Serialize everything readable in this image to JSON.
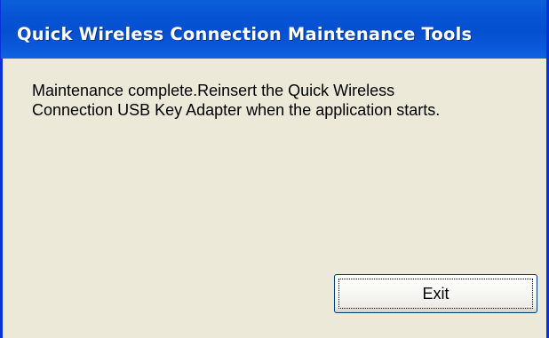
{
  "window": {
    "title": "Quick Wireless Connection Maintenance Tools"
  },
  "message": {
    "line1": "Maintenance complete.Reinsert the Quick Wireless",
    "line2": "Connection USB Key Adapter when the application starts."
  },
  "buttons": {
    "exit_label": "Exit"
  },
  "colors": {
    "title_bar": "#0553D3",
    "title_text": "#FFFFFF",
    "dialog_background": "#ECE9D8",
    "window_border": "#0831D9",
    "button_border": "#003C74"
  }
}
